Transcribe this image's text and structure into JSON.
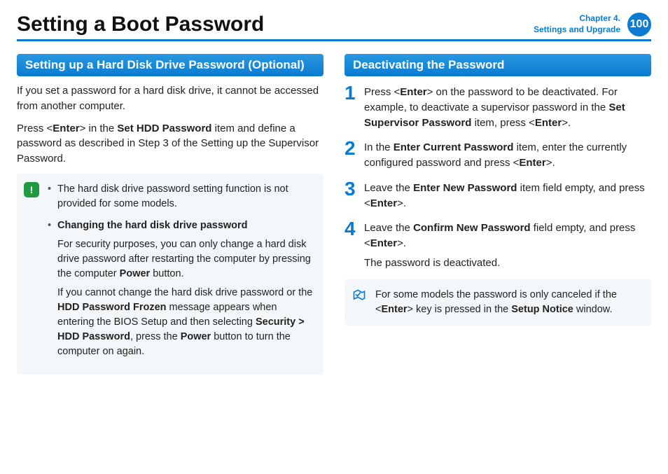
{
  "header": {
    "title": "Setting a Boot Password",
    "chapter_line1": "Chapter 4.",
    "chapter_line2": "Settings and Upgrade",
    "page_number": "100"
  },
  "left": {
    "section_title": "Setting up a Hard Disk Drive Password (Optional)",
    "intro1_a": "If you set a password for a hard disk drive, it cannot be accessed from another computer.",
    "intro2_a": "Press <",
    "intro2_b": "Enter",
    "intro2_c": "> in the ",
    "intro2_d": "Set HDD Password",
    "intro2_e": " item and define a password as described in Step 3 of the Setting up the Supervisor Password.",
    "note": {
      "icon": "!",
      "b1": "The hard disk drive password setting function is not provided for some models.",
      "b2_title": "Changing the hard disk drive password",
      "b2_p1_a": "For security purposes, you can only change a hard disk drive password after restarting the computer by pressing the computer ",
      "b2_p1_b": "Power",
      "b2_p1_c": " button.",
      "b2_p2_a": "If you cannot change the hard disk drive password or the ",
      "b2_p2_b": "HDD Password Frozen",
      "b2_p2_c": " message appears when entering the BIOS Setup and then selecting ",
      "b2_p2_d": "Security > HDD Password",
      "b2_p2_e": ", press the ",
      "b2_p2_f": "Power",
      "b2_p2_g": " button to turn the computer on again."
    }
  },
  "right": {
    "section_title": "Deactivating the Password",
    "steps": [
      {
        "n": "1",
        "a": "Press <",
        "b": "Enter",
        "c": "> on the password to be deactivated. For example, to deactivate a supervisor password in the ",
        "d": "Set Supervisor Password",
        "e": " item, press <",
        "f": "Enter",
        "g": ">."
      },
      {
        "n": "2",
        "a": "In the ",
        "b": "Enter Current Password",
        "c": " item, enter the currently configured password and press <",
        "d": "Enter",
        "e": ">."
      },
      {
        "n": "3",
        "a": "Leave the ",
        "b": "Enter New Password",
        "c": " item field empty, and press <",
        "d": "Enter",
        "e": ">."
      },
      {
        "n": "4",
        "a": "Leave the ",
        "b": "Confirm New Password",
        "c": " field empty, and press <",
        "d": "Enter",
        "e": ">.",
        "after": "The password is deactivated."
      }
    ],
    "tip": {
      "icon": "✓",
      "a": "For some models the password is only canceled if the <",
      "b": "Enter",
      "c": "> key is pressed in the ",
      "d": "Setup Notice",
      "e": " window."
    }
  }
}
